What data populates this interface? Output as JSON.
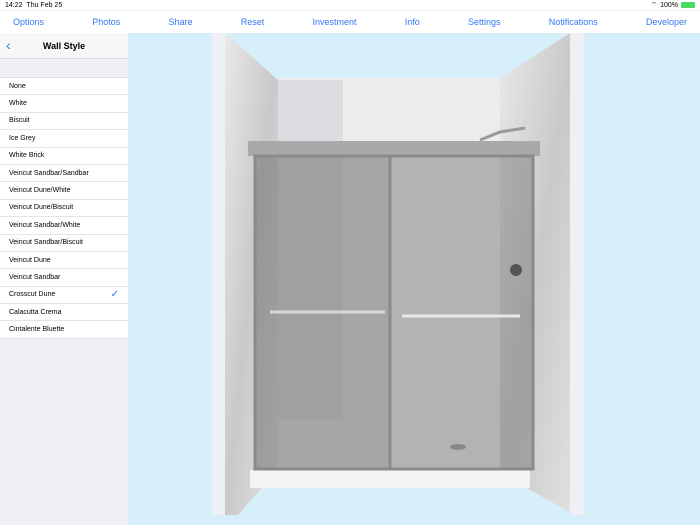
{
  "status": {
    "time": "14:22",
    "date": "Thu Feb 25",
    "battery": "100%"
  },
  "nav": [
    "Options",
    "Photos",
    "Share",
    "Reset",
    "Investment",
    "Info",
    "Settings",
    "Notifications",
    "Developer"
  ],
  "sidebar": {
    "title": "Wall Style",
    "selected": "Crosscut Dune",
    "items": [
      "None",
      "White",
      "Biscuit",
      "Ice Grey",
      "White Brick",
      "Veincut Sandbar/Sandbar",
      "Veincut Dune/White",
      "Veincut Dune/Biscuit",
      "Veincut Sandbar/White",
      "Veincut Sandbar/Biscuit",
      "Veincut Dune",
      "Veincut Sandbar",
      "Crosscut Dune",
      "Calacutta Crema",
      "Cintalente Bluette"
    ]
  }
}
